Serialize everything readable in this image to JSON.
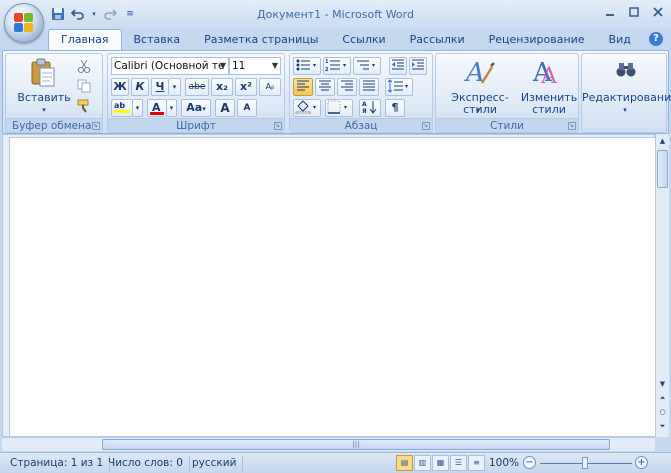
{
  "titlebar": {
    "title": "Документ1 - Microsoft Word",
    "qat_icons": [
      "save-icon",
      "undo-icon",
      "undo-dropdown-icon",
      "redo-icon",
      "customize-qat-icon"
    ],
    "window_controls": [
      "minimize-icon",
      "maximize-icon",
      "close-icon"
    ]
  },
  "tabs": [
    "Главная",
    "Вставка",
    "Разметка страницы",
    "Ссылки",
    "Рассылки",
    "Рецензирование",
    "Вид"
  ],
  "active_tab": "Главная",
  "ribbon": {
    "clipboard": {
      "label": "Буфер обмена",
      "paste": "Вставить"
    },
    "font": {
      "label": "Шрифт",
      "font_name": "Calibri (Основной те",
      "font_size": "11",
      "bold": "Ж",
      "italic": "К",
      "underline": "Ч",
      "strike": "abe",
      "subscript": "x₂",
      "superscript": "x²",
      "grow": "A",
      "shrink": "A",
      "case": "Aa"
    },
    "paragraph": {
      "label": "Абзац",
      "pilcrow": "¶"
    },
    "styles": {
      "label": "Стили",
      "quick_styles": "Экспресс-стили",
      "change_styles_line1": "Изменить",
      "change_styles_line2": "стили"
    },
    "editing": {
      "label": "Редактирование"
    }
  },
  "status": {
    "page": "Страница: 1 из 1",
    "words": "Число слов: 0",
    "language": "русский",
    "zoom": "100%",
    "zoom_out": "−",
    "zoom_in": "+"
  },
  "colors": {
    "accent": "#15428b",
    "ribbon_bg": "#dbe7f6",
    "highlight": "#ffff00",
    "font_color": "#e00000"
  }
}
